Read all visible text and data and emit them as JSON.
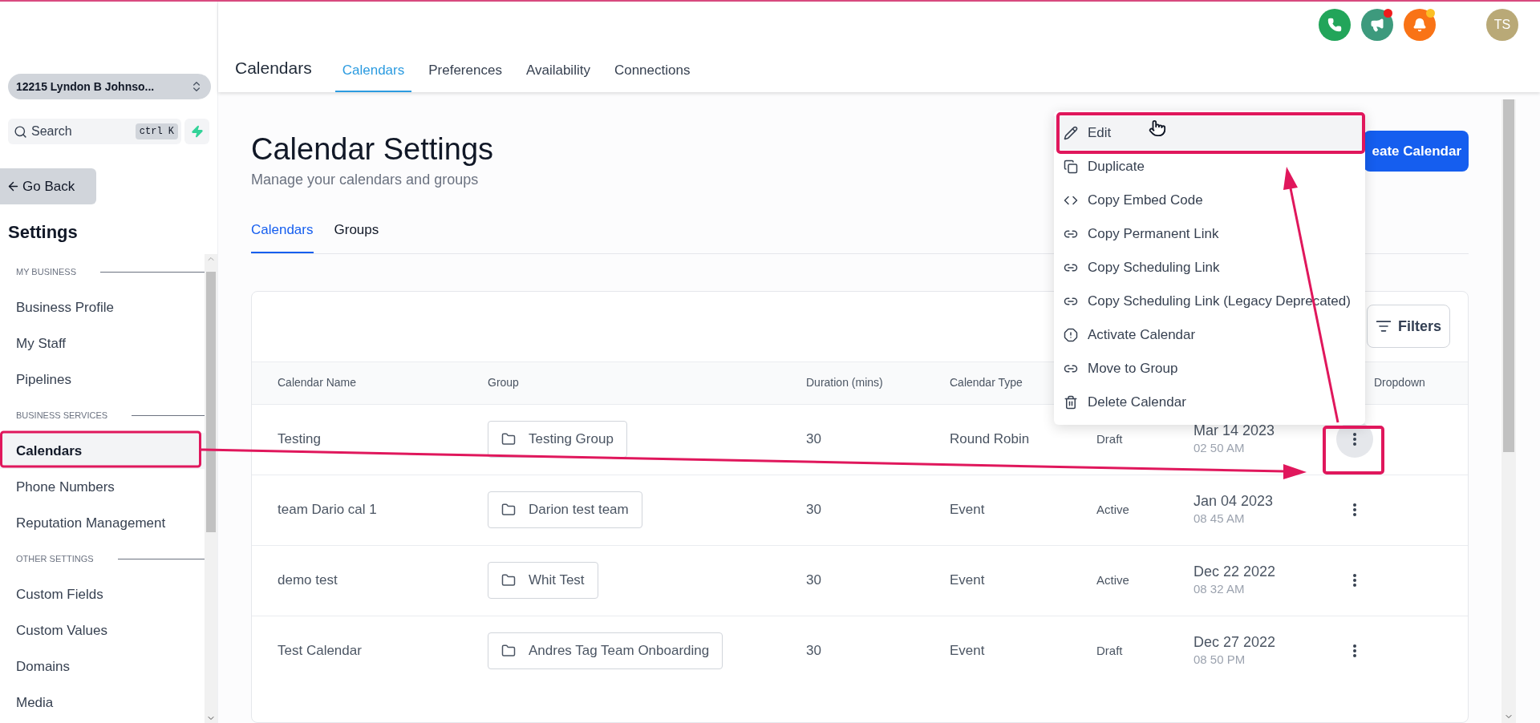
{
  "sidebar": {
    "location": "12215 Lyndon B Johnso...",
    "search": {
      "placeholder": "Search",
      "shortcut": "ctrl K"
    },
    "back_button": "Go Back",
    "title": "Settings",
    "sections": [
      {
        "label": "MY BUSINESS",
        "items": [
          {
            "label": "Business Profile",
            "selected": false
          },
          {
            "label": "My Staff",
            "selected": false
          },
          {
            "label": "Pipelines",
            "selected": false
          }
        ]
      },
      {
        "label": "BUSINESS SERVICES",
        "items": [
          {
            "label": "Calendars",
            "selected": true
          },
          {
            "label": "Phone Numbers",
            "selected": false
          },
          {
            "label": "Reputation Management",
            "selected": false
          }
        ]
      },
      {
        "label": "OTHER SETTINGS",
        "items": [
          {
            "label": "Custom Fields",
            "selected": false
          },
          {
            "label": "Custom Values",
            "selected": false
          },
          {
            "label": "Domains",
            "selected": false
          },
          {
            "label": "Media",
            "selected": false
          }
        ]
      }
    ]
  },
  "topbar": {
    "actions": [
      {
        "kind": "phone"
      },
      {
        "kind": "megaphone",
        "notification": {
          "color": "#ef1c1c"
        }
      },
      {
        "kind": "bell",
        "notification": {
          "color": "#fbbf24"
        }
      }
    ],
    "avatar": "TS"
  },
  "header": {
    "title": "Calendars",
    "tabs": [
      {
        "label": "Calendars",
        "selected": true
      },
      {
        "label": "Preferences",
        "selected": false
      },
      {
        "label": "Availability",
        "selected": false
      },
      {
        "label": "Connections",
        "selected": false
      }
    ]
  },
  "page": {
    "title": "Calendar Settings",
    "subtitle": "Manage your calendars and groups",
    "create_button": "eate Calendar",
    "tabs": [
      {
        "label": "Calendars",
        "selected": true
      },
      {
        "label": "Groups",
        "selected": false
      }
    ],
    "filters_button": "Filters",
    "table": {
      "columns": {
        "calendar_name": "Calendar Name",
        "group": "Group",
        "duration": "Duration (mins)",
        "calendar_type": "Calendar Type",
        "column_7": "Dropdown"
      },
      "rows": [
        {
          "name": "Testing",
          "group": "Testing Group",
          "duration": "30",
          "type": "Round Robin",
          "status": "Draft",
          "date": "Mar 14 2023",
          "time": "02 50 AM",
          "menu_open": true
        },
        {
          "name": "team Dario cal 1",
          "group": "Darion test team",
          "duration": "30",
          "type": "Event",
          "status": "Active",
          "date": "Jan 04 2023",
          "time": "08 45 AM",
          "menu_open": false
        },
        {
          "name": "demo test",
          "group": "Whit Test",
          "duration": "30",
          "type": "Event",
          "status": "Active",
          "date": "Dec 22 2022",
          "time": "08 32 AM",
          "menu_open": false
        },
        {
          "name": "Test Calendar",
          "group": "Andres Tag Team Onboarding",
          "duration": "30",
          "type": "Event",
          "status": "Draft",
          "date": "Dec 27 2022",
          "time": "08 50 PM",
          "menu_open": false
        }
      ]
    }
  },
  "menu": {
    "items": [
      {
        "kind": "edit",
        "label": "Edit",
        "highlighted": true
      },
      {
        "kind": "duplicate",
        "label": "Duplicate",
        "highlighted": false
      },
      {
        "kind": "code",
        "label": "Copy Embed Code",
        "highlighted": false
      },
      {
        "kind": "link",
        "label": "Copy Permanent Link",
        "highlighted": false
      },
      {
        "kind": "link",
        "label": "Copy Scheduling Link",
        "highlighted": false
      },
      {
        "kind": "link",
        "label": "Copy Scheduling Link (Legacy Deprecated)",
        "highlighted": false
      },
      {
        "kind": "activate",
        "label": "Activate Calendar",
        "highlighted": false
      },
      {
        "kind": "link",
        "label": "Move to Group",
        "highlighted": false
      },
      {
        "kind": "delete",
        "label": "Delete Calendar",
        "highlighted": false
      }
    ]
  }
}
